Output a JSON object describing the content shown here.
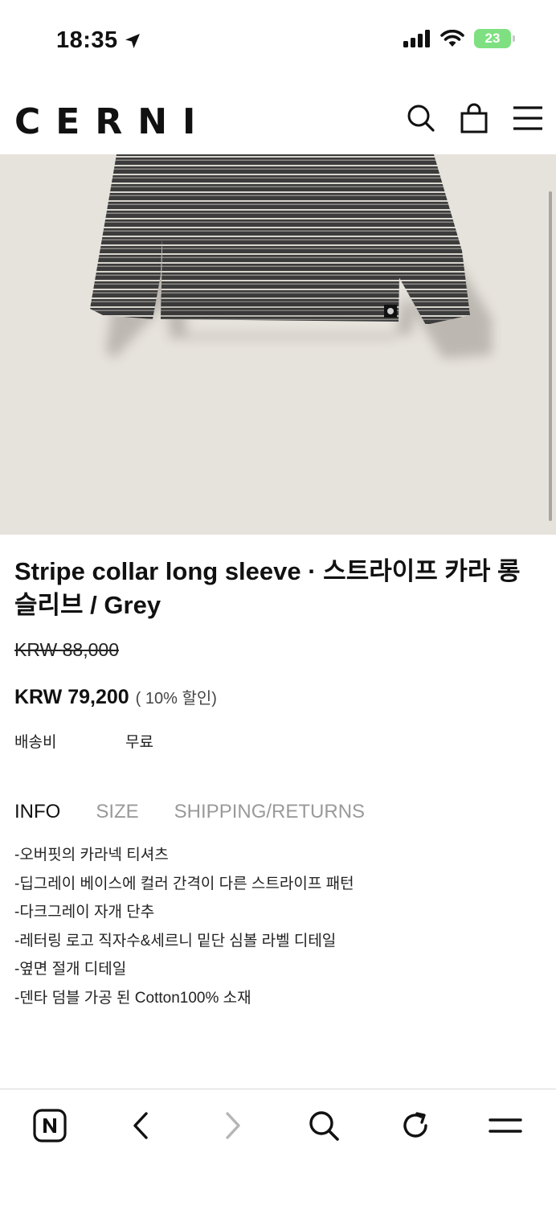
{
  "status_bar": {
    "time": "18:35",
    "battery": "23"
  },
  "header": {
    "logo": "CERNI"
  },
  "product": {
    "title": "Stripe collar long sleeve · 스트라이프 카라 롱 슬리브 / Grey",
    "original_price": "KRW 88,000",
    "sale_price": "KRW 79,200",
    "discount_note": "( 10% 할인)",
    "shipping_label": "배송비",
    "shipping_value": "무료"
  },
  "tabs": [
    {
      "label": "INFO",
      "active": true
    },
    {
      "label": "SIZE",
      "active": false
    },
    {
      "label": "SHIPPING/RETURNS",
      "active": false
    }
  ],
  "info_lines": [
    "-오버핏의 카라넥 티셔츠",
    "-딥그레이 베이스에 컬러 간격이 다른 스트라이프 패턴",
    "-다크그레이 자개 단추",
    "-레터링 로고 직자수&세르니 밑단 심볼 라벨 디테일",
    "-옆면 절개 디테일",
    "-덴타 덤블 가공 된 Cotton100% 소재"
  ],
  "icons": {
    "search": "search-icon",
    "cart": "shopping-bag-icon",
    "menu": "hamburger-menu-icon",
    "naver_home": "naver-n-icon",
    "back": "chevron-left-icon",
    "forward": "chevron-right-icon",
    "browser_search": "search-icon",
    "reload": "reload-icon",
    "browser_menu": "menu-icon"
  },
  "colors": {
    "image_background": "#e6e2dc",
    "battery": "#7ee081",
    "inactive_tab": "#9a9a9a"
  }
}
